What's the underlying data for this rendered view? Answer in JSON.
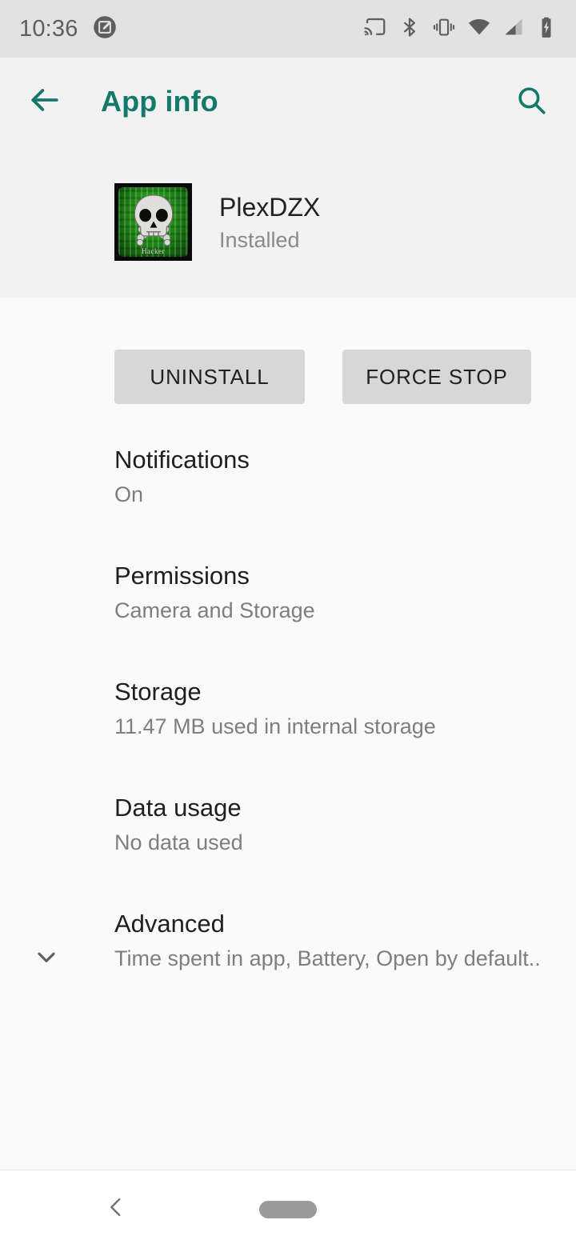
{
  "status_bar": {
    "time": "10:36",
    "left_icons": [
      {
        "name": "screenshot-notification-icon"
      }
    ],
    "right_icons": [
      {
        "name": "cast-icon"
      },
      {
        "name": "bluetooth-icon"
      },
      {
        "name": "vibrate-icon"
      },
      {
        "name": "wifi-icon"
      },
      {
        "name": "cellular-signal-icon"
      },
      {
        "name": "battery-charging-icon"
      }
    ]
  },
  "app_bar": {
    "title": "App info",
    "back_icon": "arrow-back-icon",
    "search_icon": "search-icon",
    "accent_color": "#137A6B"
  },
  "app_header": {
    "app_name": "PlexDZX",
    "app_status": "Installed",
    "icon_label": "Hacker",
    "icon_name": "app-icon-plexdzx"
  },
  "actions": {
    "uninstall_label": "UNINSTALL",
    "force_stop_label": "FORCE STOP"
  },
  "settings": [
    {
      "title": "Notifications",
      "subtitle": "On",
      "name": "notifications"
    },
    {
      "title": "Permissions",
      "subtitle": "Camera and Storage",
      "name": "permissions"
    },
    {
      "title": "Storage",
      "subtitle": "11.47 MB used in internal storage",
      "name": "storage"
    },
    {
      "title": "Data usage",
      "subtitle": "No data used",
      "name": "data-usage"
    },
    {
      "title": "Advanced",
      "subtitle": "Time spent in app, Battery, Open by default..",
      "name": "advanced",
      "expandable": true
    }
  ],
  "nav_bar": {
    "back_icon": "nav-back-icon",
    "home_handle": "nav-home-handle"
  },
  "colors": {
    "status_bar_bg": "#E2E2E2",
    "app_bar_bg": "#F2F2F2",
    "body_bg": "#FAFAFA",
    "button_bg": "#D7D7D7",
    "primary_text": "#1F1F1F",
    "secondary_text": "#7E7E7E"
  }
}
